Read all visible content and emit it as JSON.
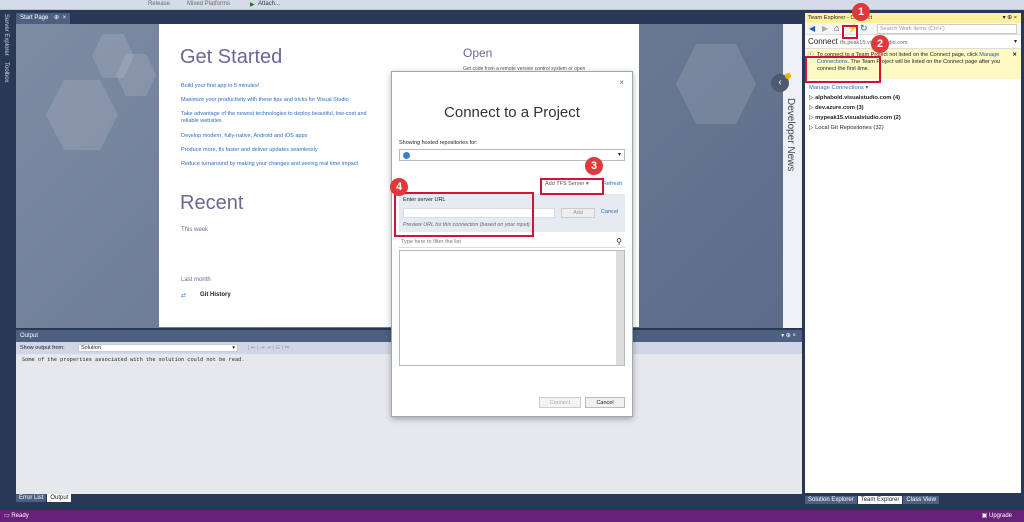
{
  "toolbar": {
    "config": "Release",
    "platform": "Mixed Platforms",
    "attach": "Attach..."
  },
  "left_strip": {
    "server_explorer": "Server Explorer",
    "toolbox": "Toolbox"
  },
  "document_tab": {
    "label": "Start Page",
    "pin": "⊕",
    "close": "×"
  },
  "start_page": {
    "get_started_title": "Get Started",
    "links": [
      "Build your first app in 5 minutes!",
      "Maximize your productivity with these tips and tricks for Visual Studio",
      "Take advantage of the newest technologies to deploy beautiful, low-cost and",
      "reliable websites",
      "Develop modern, fully-native, Android and iOS apps",
      "Produce more, fix faster and deliver updates seamlessly",
      "Reduce turnaround by making your changes and seeing real time impact"
    ],
    "recent_title": "Recent",
    "this_week": "This week",
    "last_month": "Last month",
    "git_history": "Git History",
    "open_title": "Open",
    "open_sub": "Get code from a remote version control system or open"
  },
  "developer_news": {
    "label": "Developer News",
    "collapse": "‹"
  },
  "dialog": {
    "close": "×",
    "title": "Connect to a Project",
    "repo_label": "Showing hosted repositories for:",
    "add_tfs": "Add TFS Server ▾",
    "refresh": "Refresh",
    "server_label": "Enter server URL",
    "server_value": "",
    "add_button": "Add",
    "cancel_link": "Cancel",
    "preview": "Preview URL for this connection (based on your input)",
    "filter_placeholder": "Type here to filter the list",
    "connect_button": "Connect",
    "cancel_button": "Cancel"
  },
  "callouts": [
    "1",
    "2",
    "3",
    "4"
  ],
  "team_explorer": {
    "title": "Team Explorer - Connect",
    "search_placeholder": "Search Work Items (Ctrl+')",
    "connect_label": "Connect",
    "connect_server": "tfs.peak15.visualstudio.com",
    "info_text": "To connect to a Team Project not listed on the Connect page, click",
    "info_link": "Manage Connections",
    "info_rest": ". The Team Project will be listed on the Connect page after you connect the first time.",
    "manage_connections": "Manage Connections ▾",
    "connections": [
      "alphabold.visualstudio.com (4)",
      "dev.azure.com (3)",
      "mypeak15.visualstudio.com (2)",
      "Local Git Repositories (32)"
    ],
    "bottom_tabs": [
      "Solution Explorer",
      "Team Explorer",
      "Class View"
    ]
  },
  "output": {
    "title": "Output",
    "show_from_label": "Show output from:",
    "show_from_value": "Solution",
    "text": "Some of the properties associated with the solution could not be read."
  },
  "bottom_tabs": [
    "Error List",
    "Output"
  ],
  "status": {
    "ready": "Ready",
    "upgrade": "Upgrade"
  }
}
